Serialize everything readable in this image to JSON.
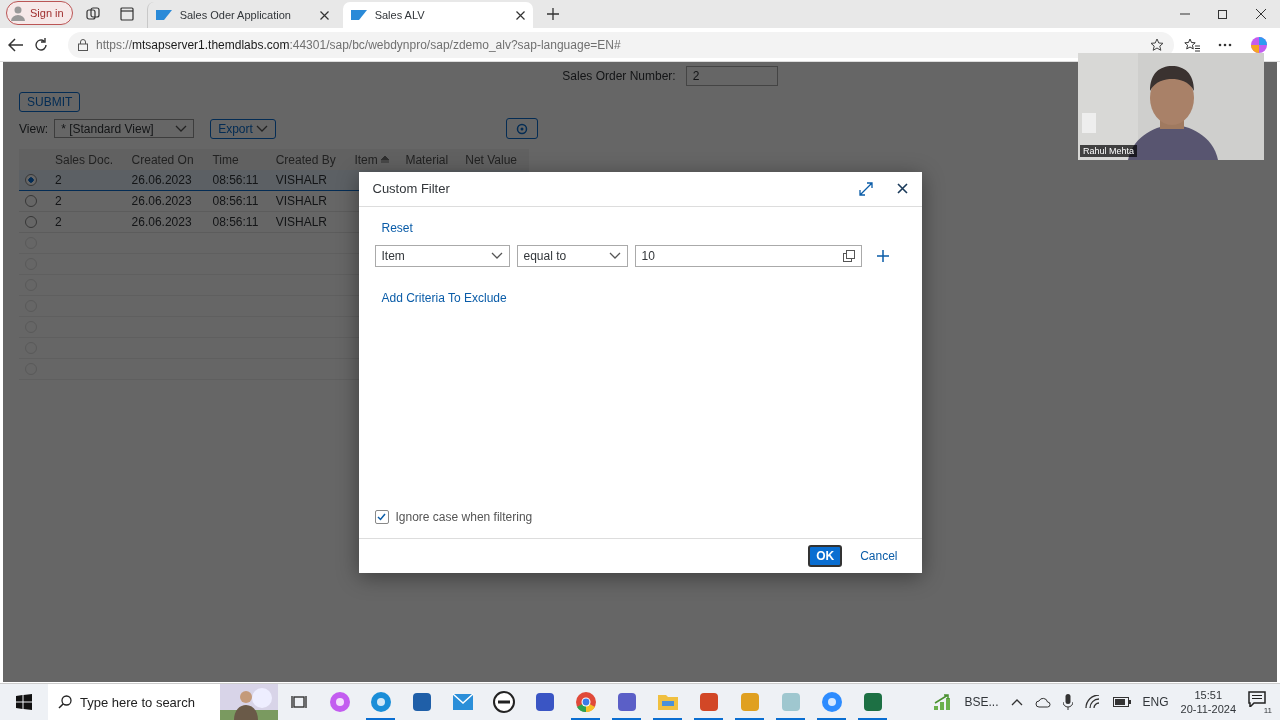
{
  "browser": {
    "sign_in": "Sign in",
    "tabs": [
      {
        "title": "Sales Oder Application",
        "selected": false
      },
      {
        "title": "Sales ALV",
        "selected": true
      }
    ],
    "url": {
      "scheme": "https://",
      "host": "mtsapserver1.themdlabs.com",
      "rest": ":44301/sap/bc/webdynpro/sap/zdemo_alv?sap-language=EN#"
    }
  },
  "page": {
    "order_label": "Sales Order Number:",
    "order_value": "2",
    "submit": "SUBMIT",
    "view_label": "View:",
    "view_value": "* [Standard View]",
    "export": "Export",
    "table": {
      "columns": [
        "Sales Doc.",
        "Created On",
        "Time",
        "Created By",
        "Item",
        "Material",
        "Net Value"
      ],
      "rows": [
        {
          "selected": true,
          "cells": [
            "2",
            "26.06.2023",
            "08:56:11",
            "VISHALR"
          ]
        },
        {
          "selected": false,
          "cells": [
            "2",
            "26.06.2023",
            "08:56:11",
            "VISHALR"
          ]
        },
        {
          "selected": false,
          "cells": [
            "2",
            "26.06.2023",
            "08:56:11",
            "VISHALR"
          ]
        },
        {
          "selected": false
        },
        {
          "selected": false
        },
        {
          "selected": false
        },
        {
          "selected": false
        },
        {
          "selected": false
        },
        {
          "selected": false
        },
        {
          "selected": false
        }
      ]
    }
  },
  "dialog": {
    "title": "Custom Filter",
    "reset": "Reset",
    "field": "Item",
    "operator": "equal to",
    "value": "10",
    "exclude_link": "Add Criteria To Exclude",
    "ignore_case": {
      "label": "Ignore case when filtering",
      "checked": true
    },
    "ok": "OK",
    "cancel": "Cancel"
  },
  "webcam": {
    "name": "Rahul Mehta"
  },
  "taskbar": {
    "search_placeholder": "Type here to search",
    "apps": [
      {
        "kind": "taskview",
        "running": false
      },
      {
        "kind": "copilot",
        "running": false
      },
      {
        "kind": "edge",
        "running": true
      },
      {
        "kind": "store",
        "running": false
      },
      {
        "kind": "mail",
        "running": false
      },
      {
        "kind": "dell",
        "running": false
      },
      {
        "kind": "network",
        "running": false
      },
      {
        "kind": "chrome",
        "running": true
      },
      {
        "kind": "teams",
        "running": true
      },
      {
        "kind": "explorer",
        "running": true
      },
      {
        "kind": "powerpoint",
        "running": true
      },
      {
        "kind": "pen",
        "running": true
      },
      {
        "kind": "notepad",
        "running": true
      },
      {
        "kind": "zoom",
        "running": true
      },
      {
        "kind": "excel",
        "running": true
      }
    ],
    "widget": "BSE...",
    "language": "ENG",
    "time": "15:51",
    "date": "20-11-2024",
    "notifications": "11"
  }
}
